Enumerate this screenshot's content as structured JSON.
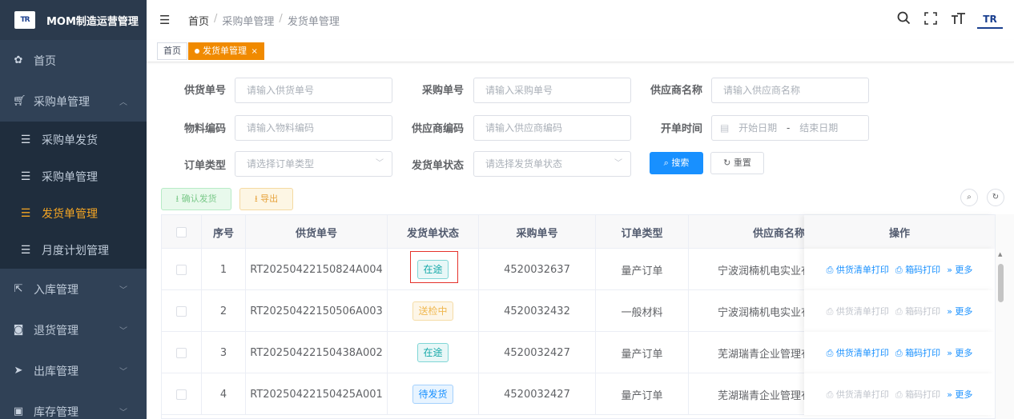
{
  "app": {
    "logo": "TR",
    "title": "MOM制造运营管理"
  },
  "sidebar": {
    "items": [
      {
        "label": "首页",
        "icon": "dashboard-icon"
      },
      {
        "label": "采购单管理",
        "icon": "cart-icon",
        "expanded": true,
        "children": [
          {
            "label": "采购单发货"
          },
          {
            "label": "采购单管理"
          },
          {
            "label": "发货单管理",
            "active": true
          },
          {
            "label": "月度计划管理"
          }
        ]
      },
      {
        "label": "入库管理",
        "icon": "external-link-icon"
      },
      {
        "label": "退货管理",
        "icon": "return-icon"
      },
      {
        "label": "出库管理",
        "icon": "send-icon"
      },
      {
        "label": "库存管理",
        "icon": "storage-icon"
      }
    ]
  },
  "header": {
    "breadcrumb": [
      "首页",
      "采购单管理",
      "发货单管理"
    ],
    "separator": "/",
    "avatar": "TR"
  },
  "tags": {
    "home": "首页",
    "active": "发货单管理",
    "close": "×"
  },
  "filters": {
    "supply_no": {
      "label": "供货单号",
      "placeholder": "请输入供货单号"
    },
    "po_no": {
      "label": "采购单号",
      "placeholder": "请输入采购单号"
    },
    "supplier_name": {
      "label": "供应商名称",
      "placeholder": "请输入供应商名称"
    },
    "material_code": {
      "label": "物料编码",
      "placeholder": "请输入物料编码"
    },
    "supplier_code": {
      "label": "供应商编码",
      "placeholder": "请输入供应商编码"
    },
    "open_time": {
      "label": "开单时间",
      "start": "开始日期",
      "dash": "-",
      "end": "结束日期"
    },
    "order_type": {
      "label": "订单类型",
      "placeholder": "请选择订单类型"
    },
    "ship_status": {
      "label": "发货单状态",
      "placeholder": "请选择发货单状态"
    },
    "search_btn": "搜索",
    "reset_btn": "重置"
  },
  "toolbar": {
    "confirm": "确认发货",
    "export": "导出"
  },
  "table": {
    "headers": [
      "序号",
      "供货单号",
      "发货单状态",
      "采购单号",
      "订单类型",
      "供应商名称",
      "操作"
    ],
    "rows": [
      {
        "idx": "1",
        "supply_no": "RT20250422150824A004",
        "status": "在途",
        "po_no": "4520032637",
        "order_type": "量产订单",
        "supplier": "宁波润楠机电实业有",
        "ops_active": true
      },
      {
        "idx": "2",
        "supply_no": "RT20250422150506A003",
        "status": "送检中",
        "po_no": "4520032432",
        "order_type": "一般材料",
        "supplier": "宁波润楠机电实业有",
        "ops_active": false
      },
      {
        "idx": "3",
        "supply_no": "RT20250422150438A002",
        "status": "在途",
        "po_no": "4520032427",
        "order_type": "量产订单",
        "supplier": "芜湖瑞青企业管理有",
        "ops_active": true
      },
      {
        "idx": "4",
        "supply_no": "RT20250422150425A001",
        "status": "待发货",
        "po_no": "4520032427",
        "order_type": "量产订单",
        "supplier": "芜湖瑞青企业管理有",
        "ops_active": false
      }
    ],
    "ops": {
      "print_list": "供货清单打印",
      "print_box": "箱码打印",
      "more": "更多"
    }
  },
  "colors": {
    "sidebar_bg": "#304156",
    "active_menu": "#f6a623",
    "primary": "#1890ff",
    "tag_active": "#f08a00",
    "highlight": "#e5322b"
  }
}
